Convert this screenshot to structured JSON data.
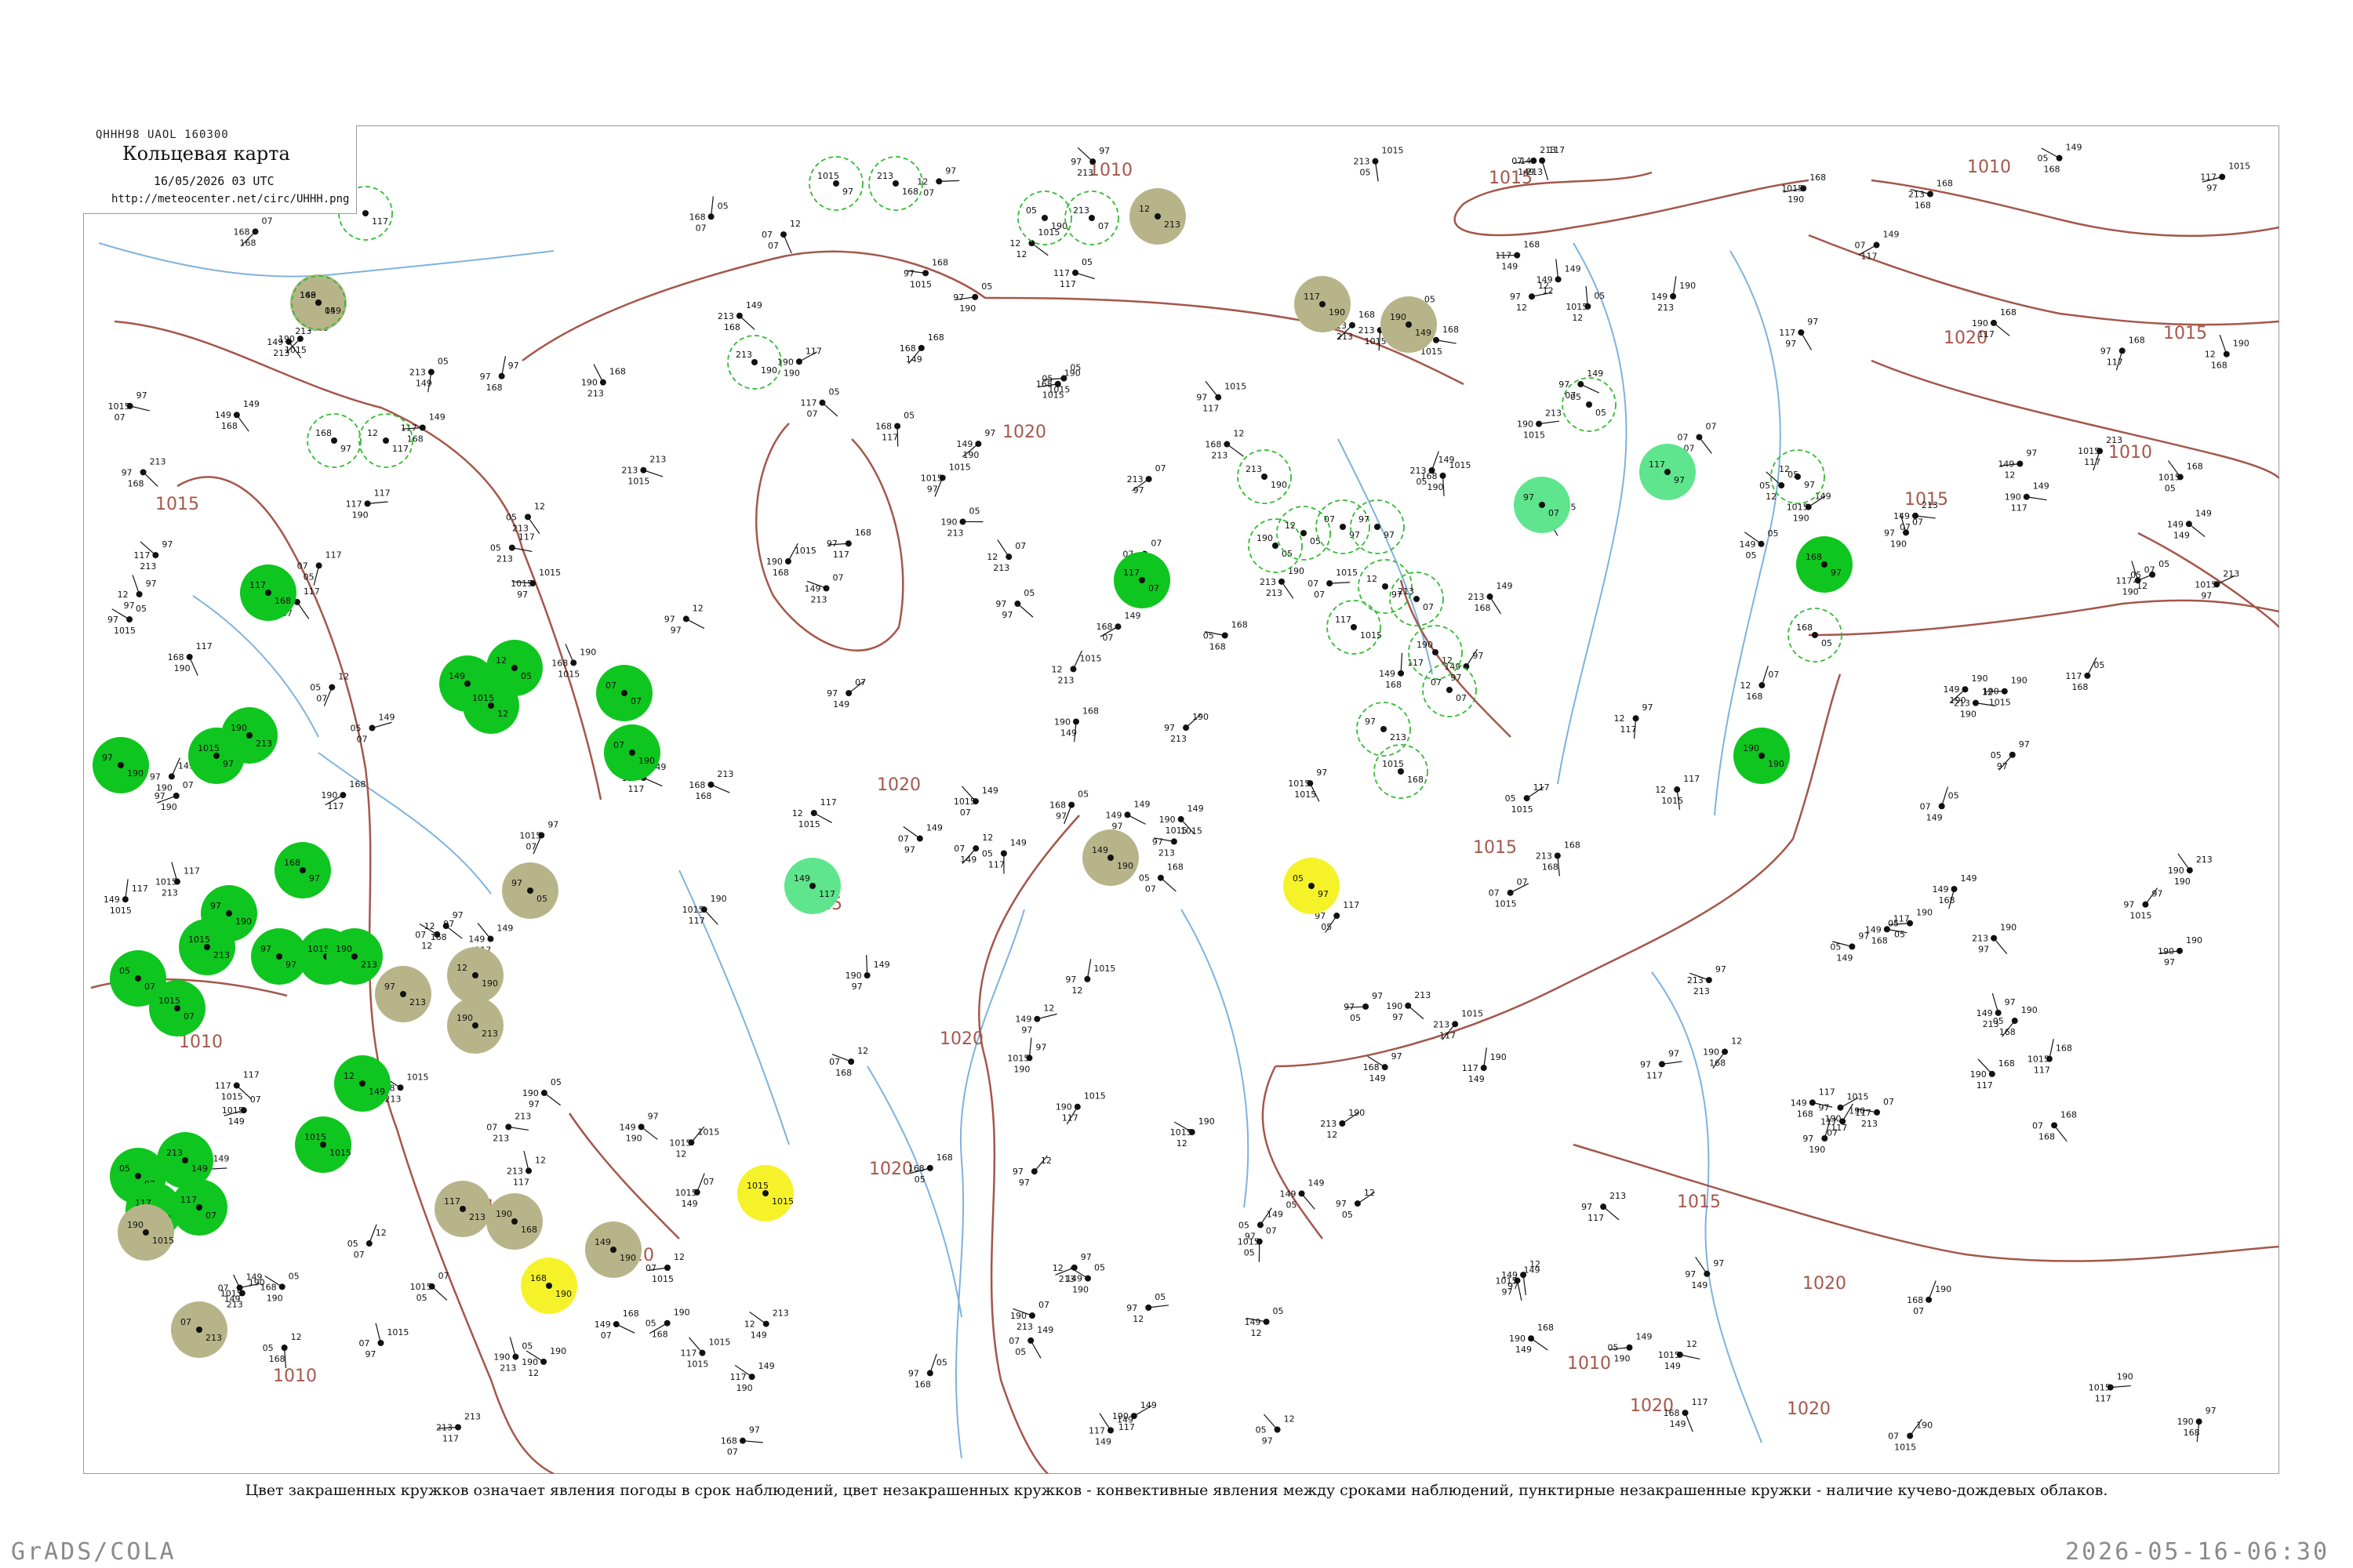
{
  "header": {
    "code_line": "QHHH98  UAOL  160300",
    "title": "Кольцевая карта",
    "datetime": "16/05/2026 03 UTC",
    "url": "http://meteocenter.net/circ/UHHH.png"
  },
  "caption": "Цвет закрашенных кружков означает явления погоды в срок наблюдений, цвет незакрашенных кружков - конвективные явления между сроками наблюдений, пунктирные незакрашенные кружки - наличие кучево-дождевых облаков.",
  "footer": {
    "left": "GrADS/COLA",
    "right": "2026-05-16-06:30"
  },
  "colors": {
    "isobar": "#a4574a",
    "river": "#7fb2dd",
    "frame": "#9a9a9a",
    "rain_station": "#0fc51f",
    "haze_station": "#b8b48a",
    "fog_station": "#f6f22a",
    "shower_station": "#5fe58d",
    "cb_circle": "#33bb33"
  },
  "isobar_labels": [
    "1010",
    "1015",
    "1020"
  ],
  "station_groups": {
    "rain_filled": {
      "icon": "green-filled-circle",
      "count": 26
    },
    "haze_filled": {
      "icon": "khaki-filled-circle",
      "count": 14
    },
    "fog_filled": {
      "icon": "yellow-filled-circle",
      "count": 3
    },
    "shower_filled": {
      "icon": "light-green-filled-circle",
      "count": 3
    },
    "cb_dashed": {
      "icon": "green-dashed-circle",
      "count": 22
    },
    "plain": {
      "icon": "station-model-dot"
    }
  },
  "sample_station_values": [
    "97",
    "149",
    "168",
    "213",
    "05",
    "07",
    "117",
    "190",
    "12",
    "1015"
  ]
}
